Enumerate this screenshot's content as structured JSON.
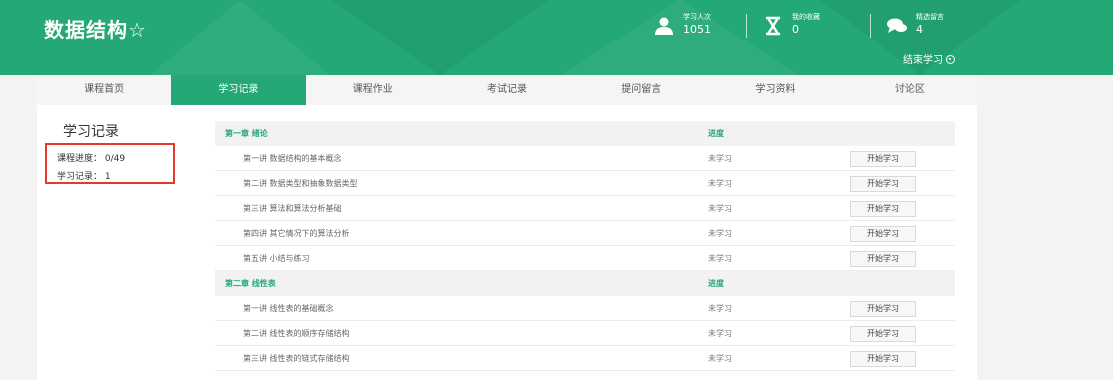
{
  "header": {
    "course_title": "数据结构☆",
    "stats": [
      {
        "label": "学习人次",
        "value": "1051",
        "icon": "user-icon"
      },
      {
        "label": "我的收藏",
        "value": "0",
        "icon": "hourglass-icon"
      },
      {
        "label": "精选留言",
        "value": "4",
        "icon": "chat-icon"
      }
    ],
    "end_study_label": "结束学习"
  },
  "tabs": [
    {
      "label": "课程首页",
      "active": false
    },
    {
      "label": "学习记录",
      "active": true
    },
    {
      "label": "课程作业",
      "active": false
    },
    {
      "label": "考试记录",
      "active": false
    },
    {
      "label": "提问留言",
      "active": false
    },
    {
      "label": "学习资料",
      "active": false
    },
    {
      "label": "讨论区",
      "active": false
    }
  ],
  "sidebar": {
    "title": "学习记录",
    "progress": "课程进度： 0/49",
    "records": "学习记录： 1"
  },
  "chapters": [
    {
      "name": "第一章 绪论",
      "progress_header": "进度",
      "lessons": [
        {
          "name": "第一讲 数据结构的基本概念",
          "status": "未学习",
          "action": "开始学习"
        },
        {
          "name": "第二讲 数据类型和抽象数据类型",
          "status": "未学习",
          "action": "开始学习"
        },
        {
          "name": "第三讲 算法和算法分析基础",
          "status": "未学习",
          "action": "开始学习"
        },
        {
          "name": "第四讲 其它情况下的算法分析",
          "status": "未学习",
          "action": "开始学习"
        },
        {
          "name": "第五讲 小结与练习",
          "status": "未学习",
          "action": "开始学习"
        }
      ]
    },
    {
      "name": "第二章 线性表",
      "progress_header": "进度",
      "lessons": [
        {
          "name": "第一讲 线性表的基础概念",
          "status": "未学习",
          "action": "开始学习"
        },
        {
          "name": "第二讲 线性表的顺序存储结构",
          "status": "未学习",
          "action": "开始学习"
        },
        {
          "name": "第三讲 线性表的链式存储结构",
          "status": "未学习",
          "action": "开始学习"
        }
      ]
    }
  ],
  "colors": {
    "brand": "#24a876",
    "highlight_border": "#e23a2e"
  }
}
